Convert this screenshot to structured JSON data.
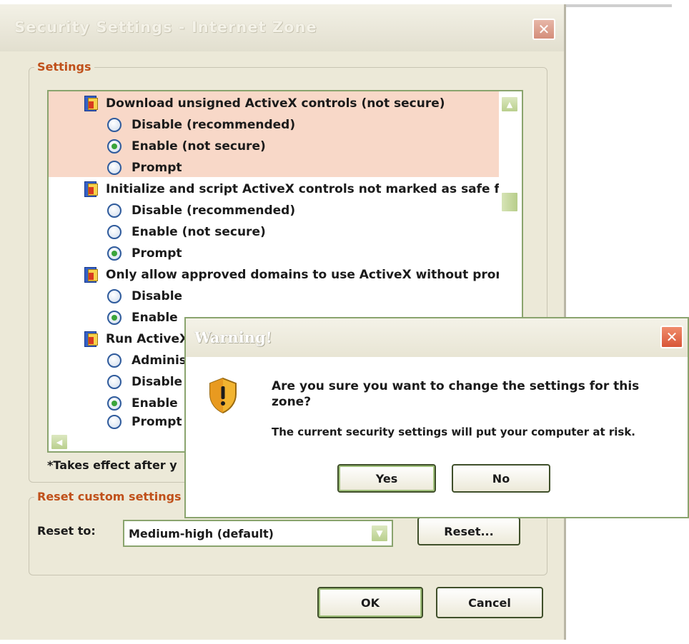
{
  "window": {
    "title": "Security Settings - Internet Zone",
    "close_glyph": "✕"
  },
  "settings_group": {
    "label": "Settings",
    "items": [
      {
        "label": "Download unsigned ActiveX controls (not secure)",
        "highlighted": true,
        "options": [
          {
            "label": "Disable (recommended)",
            "checked": false
          },
          {
            "label": "Enable (not secure)",
            "checked": true
          },
          {
            "label": "Prompt",
            "checked": false
          }
        ]
      },
      {
        "label": "Initialize and script ActiveX controls not marked as safe for s",
        "options": [
          {
            "label": "Disable (recommended)",
            "checked": false
          },
          {
            "label": "Enable (not secure)",
            "checked": false
          },
          {
            "label": "Prompt",
            "checked": true
          }
        ]
      },
      {
        "label": "Only allow approved domains to use ActiveX without prompt",
        "options": [
          {
            "label": "Disable",
            "checked": false
          },
          {
            "label": "Enable",
            "checked": true
          }
        ]
      },
      {
        "label": "Run ActiveX",
        "options": [
          {
            "label": "Administ",
            "checked": false
          },
          {
            "label": "Disable",
            "checked": false
          },
          {
            "label": "Enable",
            "checked": true
          },
          {
            "label": "Prompt",
            "checked": false
          }
        ]
      }
    ],
    "footnote": "*Takes effect after y"
  },
  "reset_group": {
    "label": "Reset custom settings",
    "reset_to_label": "Reset to:",
    "combo_value": "Medium-high (default)",
    "reset_button": "Reset..."
  },
  "footer": {
    "ok": "OK",
    "cancel": "Cancel"
  },
  "warning": {
    "title": "Warning!",
    "question": "Are you sure you want to change the settings for this zone?",
    "message": "The current security settings will put your computer at risk.",
    "yes": "Yes",
    "no": "No",
    "close_glyph": "✕"
  },
  "colors": {
    "highlight": "#f8d8c8",
    "group_label": "#c0501a",
    "border_green": "#8aa46e"
  },
  "icons": [
    "close-icon",
    "setting-category-icon",
    "radio-icon",
    "scroll-up-icon",
    "scroll-left-icon",
    "dropdown-arrow-icon",
    "warning-shield-icon"
  ]
}
